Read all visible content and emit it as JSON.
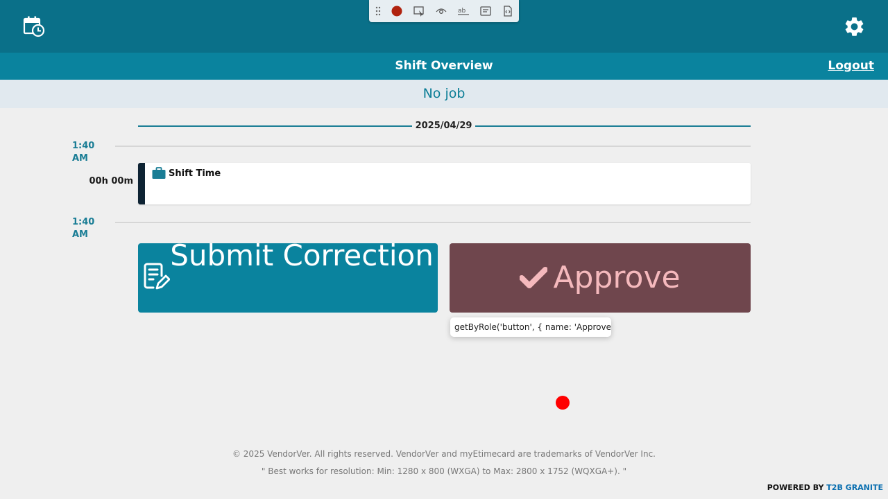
{
  "header": {
    "calendar_icon": "calendar-clock-icon",
    "settings_icon": "gear-icon",
    "title": "Shift Overview",
    "logout_label": "Logout",
    "job_status": "No job"
  },
  "recorder_toolbar": {
    "icons": [
      "drag-handle-icon",
      "record-icon",
      "pick-locator-icon",
      "assert-visibility-icon",
      "assert-text-icon",
      "assert-value-icon",
      "assert-snapshot-icon"
    ],
    "record_color": "#b0230f"
  },
  "timeline": {
    "date": "2025/04/29",
    "start_time": "1:40 AM",
    "end_time": "1:40 AM",
    "duration": "00h 00m",
    "shift_label": "Shift Time",
    "shift_icon": "briefcase-icon"
  },
  "actions": {
    "submit_correction_label": "Submit Correction",
    "approve_label": "Approve",
    "tooltip": "getByRole('button', { name: 'Approve' })"
  },
  "footer": {
    "copyright": "© 2025 VendorVer. All rights reserved. VendorVer and myEtimecard are trademarks of VendorVer Inc.",
    "resolution_note": "\" Best works for resolution: Min: 1280 x 800 (WXGA) to Max: 2800 x 1752 (WQXGA+). \"",
    "powered_prefix": "POWERED BY",
    "powered_brand": "T2B GRANITE"
  },
  "colors": {
    "header_bg": "#0a7089",
    "subheader_bg": "#0a839e",
    "accent_teal": "#1a7d95",
    "approve_bg": "#6f464d",
    "approve_text": "#f5b9bd",
    "cursor_dot": "#ff0000"
  }
}
